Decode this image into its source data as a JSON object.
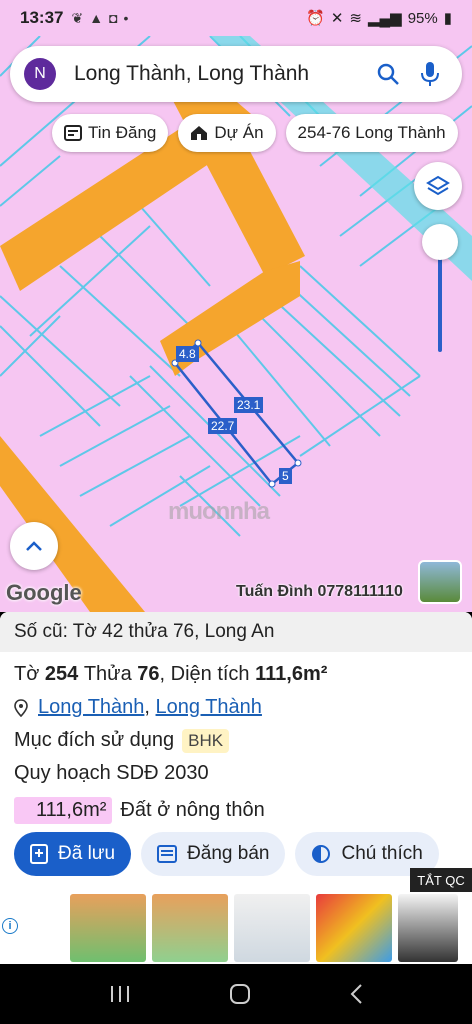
{
  "status_bar": {
    "time": "13:37",
    "battery": "95%"
  },
  "search": {
    "avatar_letter": "N",
    "query": "Long Thành, Long Thành"
  },
  "chips": [
    {
      "label": "Tin Đăng",
      "icon": "newspaper-icon"
    },
    {
      "label": "Dự Án",
      "icon": "house-icon"
    },
    {
      "label": "254-76 Long Thành",
      "icon": ""
    }
  ],
  "map": {
    "dimensions": {
      "top": "4.8",
      "long_right": "23.1",
      "long_left": "22.7",
      "bottom": "5"
    },
    "attribution": "Google",
    "credit": "Tuấn Đình 0778111110",
    "watermark": "muonnha",
    "colors": {
      "land": "#f6c6f2",
      "road": "#f5a52d",
      "parcel_line": "#5ec8e8",
      "highlight": "#2b5fc9"
    }
  },
  "panel": {
    "old_info": "Số cũ: Tờ 42 thửa 76, Long An",
    "to_label": "Tờ",
    "to_value": "254",
    "thua_label": "Thửa",
    "thua_value": "76",
    "area_label": ", Diện tích",
    "area_value": "111,6m²",
    "location_1": "Long Thành",
    "location_sep": ",",
    "location_2": "Long Thành",
    "purpose_label": "Mục đích sử dụng",
    "purpose_tag": "BHK",
    "planning": "Quy hoạch SDĐ 2030",
    "plan_area": "111,6m²",
    "plan_type": "Đất ở nông thôn"
  },
  "actions": [
    {
      "label": "Đã lưu",
      "icon": "bookmark-plus-icon"
    },
    {
      "label": "Đăng bán",
      "icon": "list-icon"
    },
    {
      "label": "Chú thích",
      "icon": "half-circle-icon"
    }
  ],
  "ad": {
    "close_label": "TẮT QC"
  }
}
